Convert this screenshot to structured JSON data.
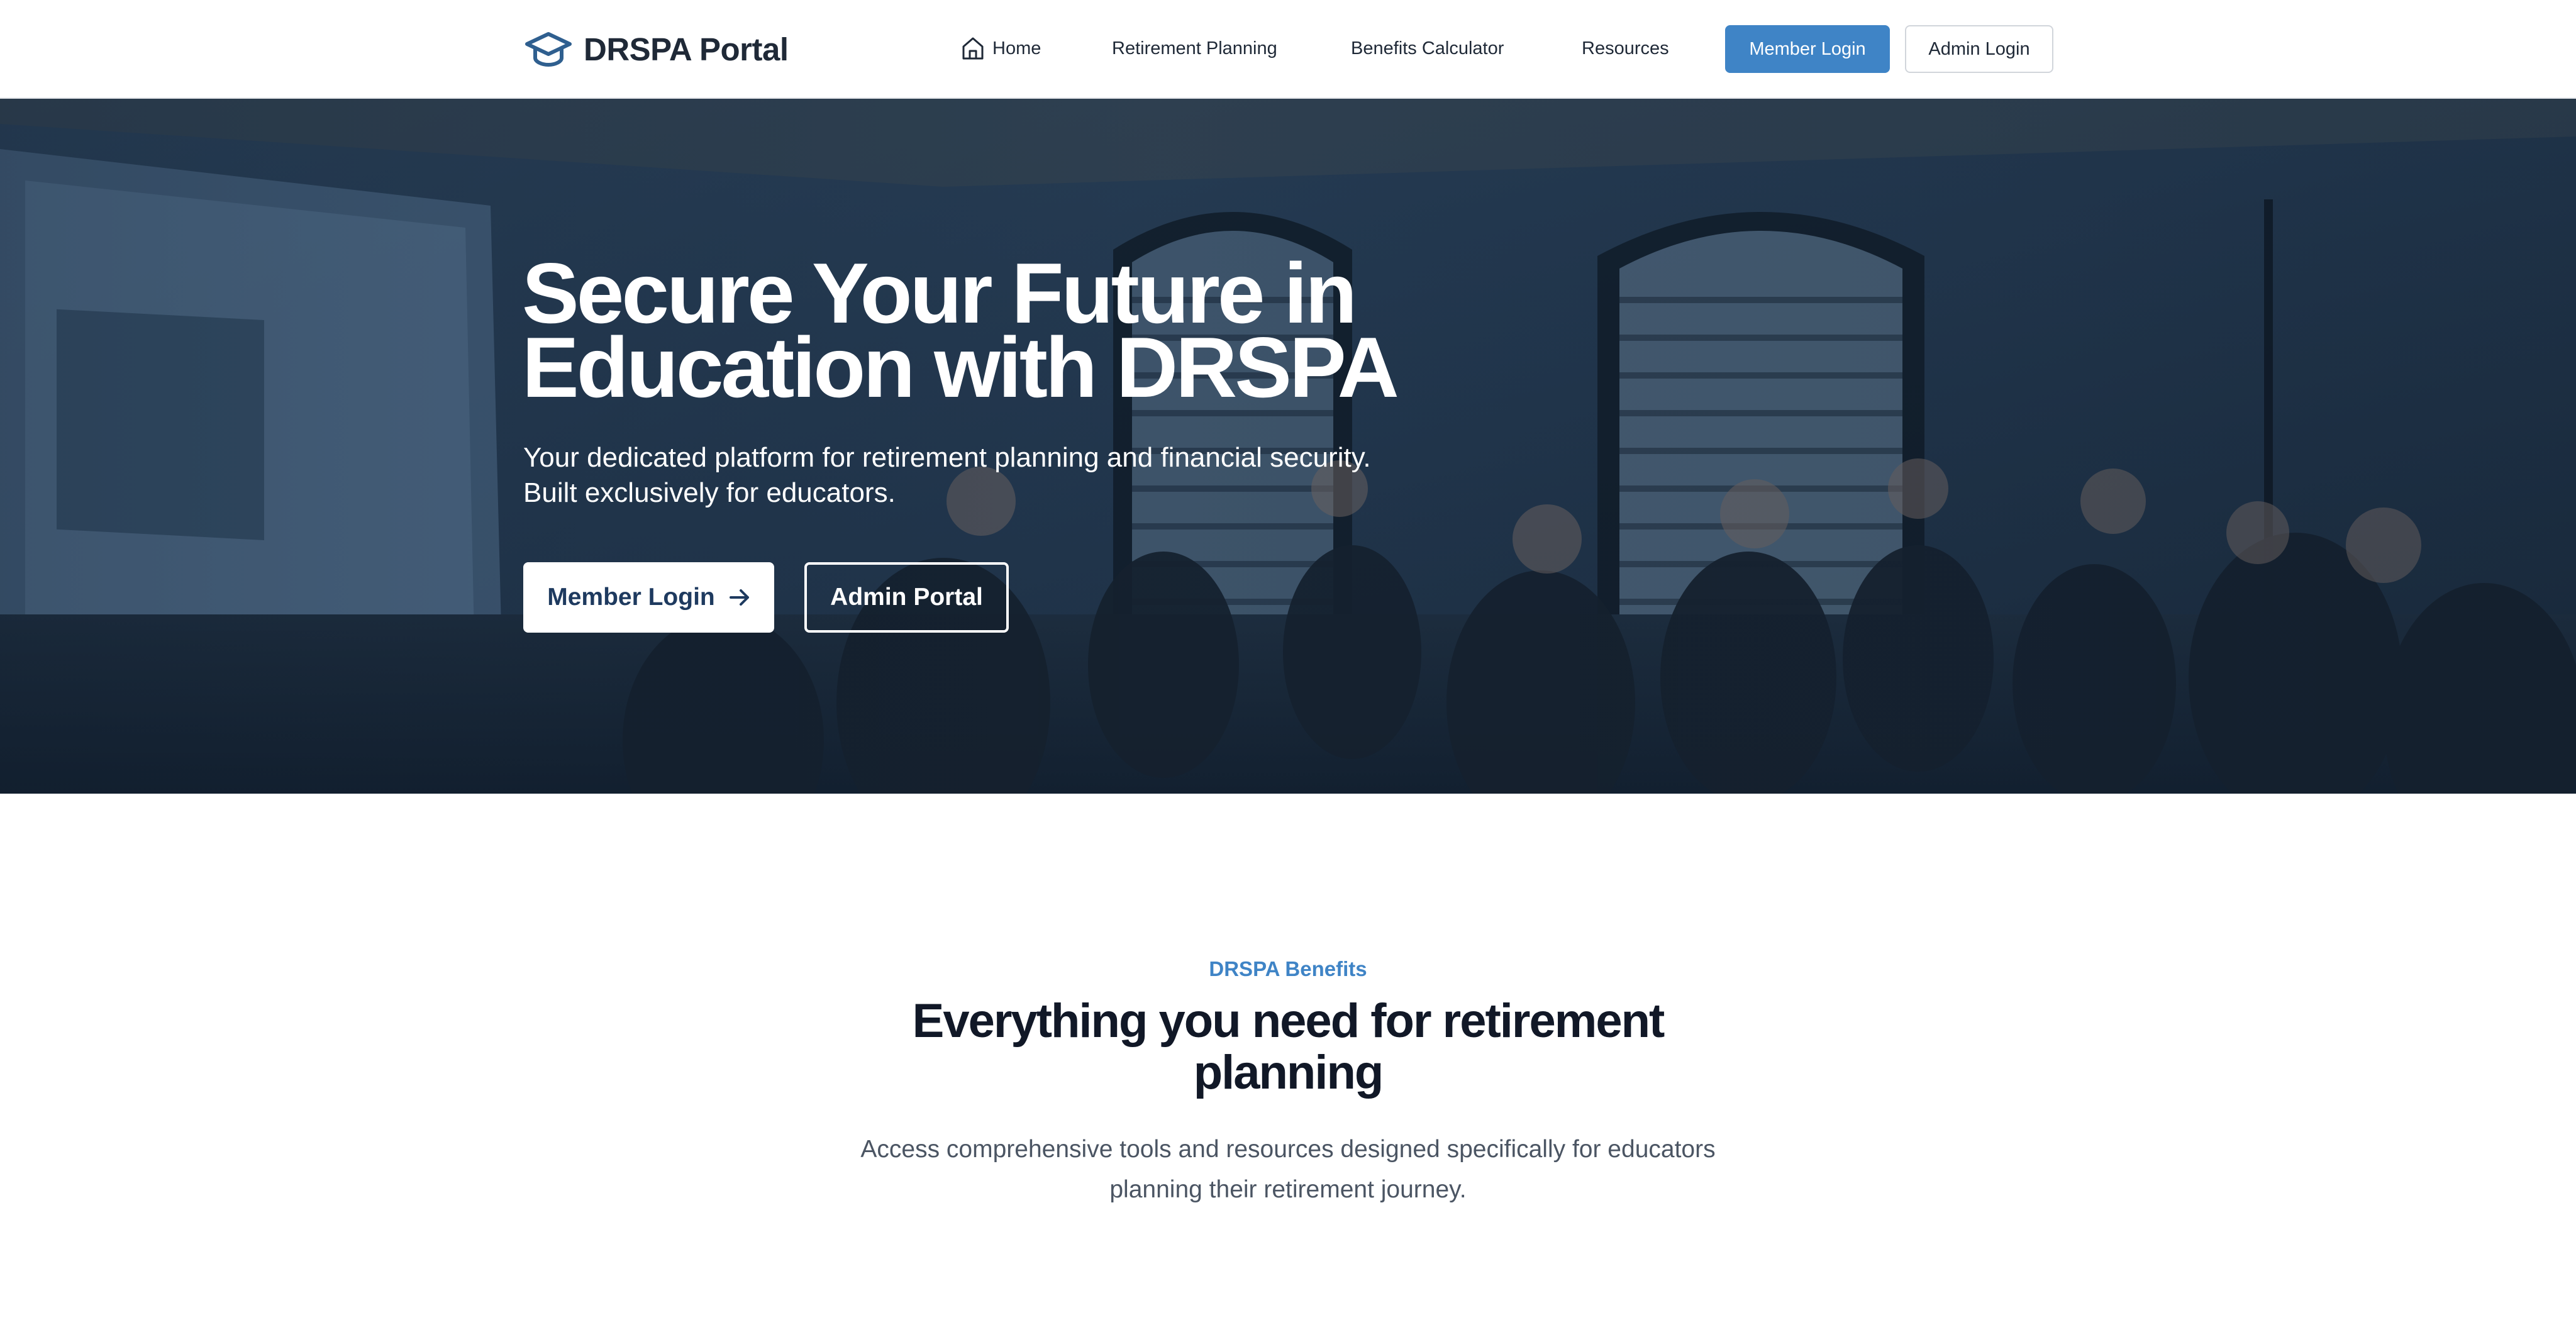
{
  "header": {
    "brand": "DRSPA Portal",
    "brand_icon": "graduation-cap-icon",
    "nav": {
      "home": "Home",
      "home_icon": "home-icon",
      "retirement_planning": "Retirement Planning",
      "benefits_calculator": "Benefits Calculator",
      "resources": "Resources"
    },
    "member_login": "Member Login",
    "admin_login": "Admin Login"
  },
  "hero": {
    "title": "Secure Your Future in Education with DRSPA",
    "subtitle": "Your dedicated platform for retirement planning and financial security. Built exclusively for educators.",
    "member_login": "Member Login",
    "admin_portal": "Admin Portal",
    "arrow_icon": "arrow-right-icon"
  },
  "benefits": {
    "eyebrow": "DRSPA Benefits",
    "title": "Everything you need for retirement planning",
    "description": "Access comprehensive tools and resources designed specifically for educators planning their retirement journey."
  },
  "colors": {
    "accent": "#3f84c6",
    "hero_overlay": "#1b2a3c",
    "text_dark": "#111827"
  }
}
